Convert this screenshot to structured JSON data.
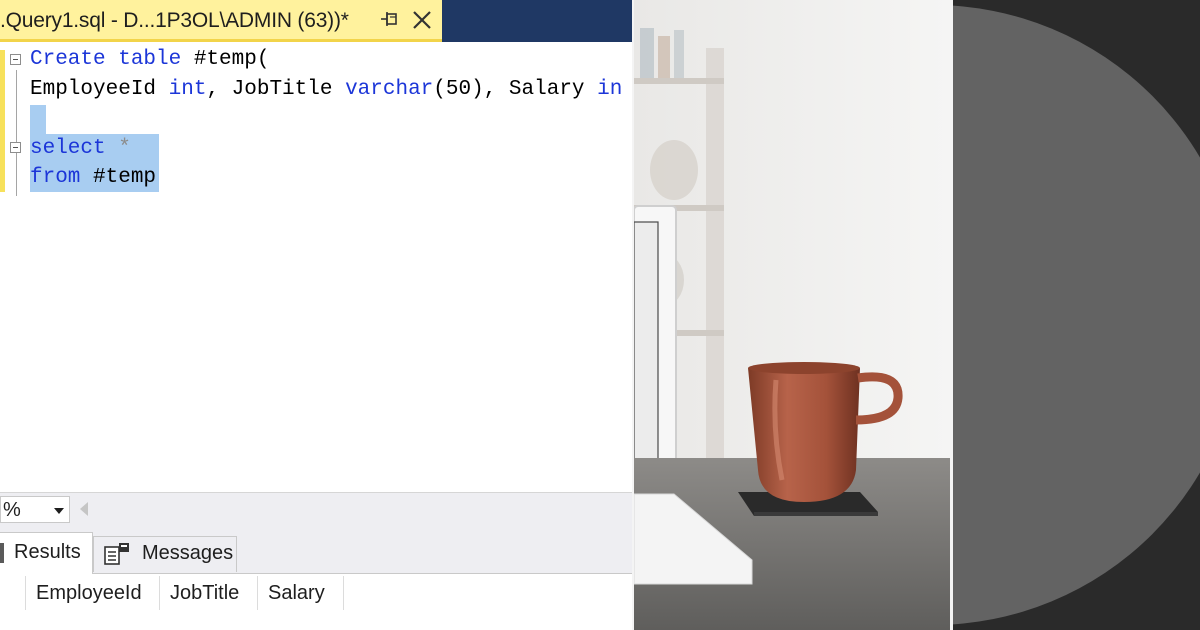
{
  "tab": {
    "title": ".Query1.sql - D...1P3OL\\ADMIN (63))*"
  },
  "editor": {
    "line1": {
      "kw": "Create table",
      "rest": " #temp("
    },
    "line2": {
      "a": "EmployeeId ",
      "kw1": "int",
      "b": ", JobTitle ",
      "kw2": "varchar",
      "c": "(",
      "num": "50",
      "d": "), Salary ",
      "kw3": "in"
    },
    "line4": {
      "kw": "select",
      "op": " *"
    },
    "line5": {
      "kw": "from",
      "rest": " #temp"
    }
  },
  "statusbar": {
    "zoom": "%"
  },
  "results": {
    "tabs": {
      "results": "Results",
      "messages": "Messages"
    },
    "columns": [
      "EmployeeId",
      "JobTitle",
      "Salary"
    ]
  },
  "colors": {
    "keyword": "#1c36d8",
    "tab_highlight": "#fff29d",
    "selection": "#a8cdf1",
    "dark_panel": "#2a2a2a",
    "circle": "#636363"
  },
  "icons": [
    "pin-icon",
    "close-icon",
    "fold-icon",
    "zoom-dropdown-icon",
    "results-grid-icon",
    "messages-icon"
  ]
}
